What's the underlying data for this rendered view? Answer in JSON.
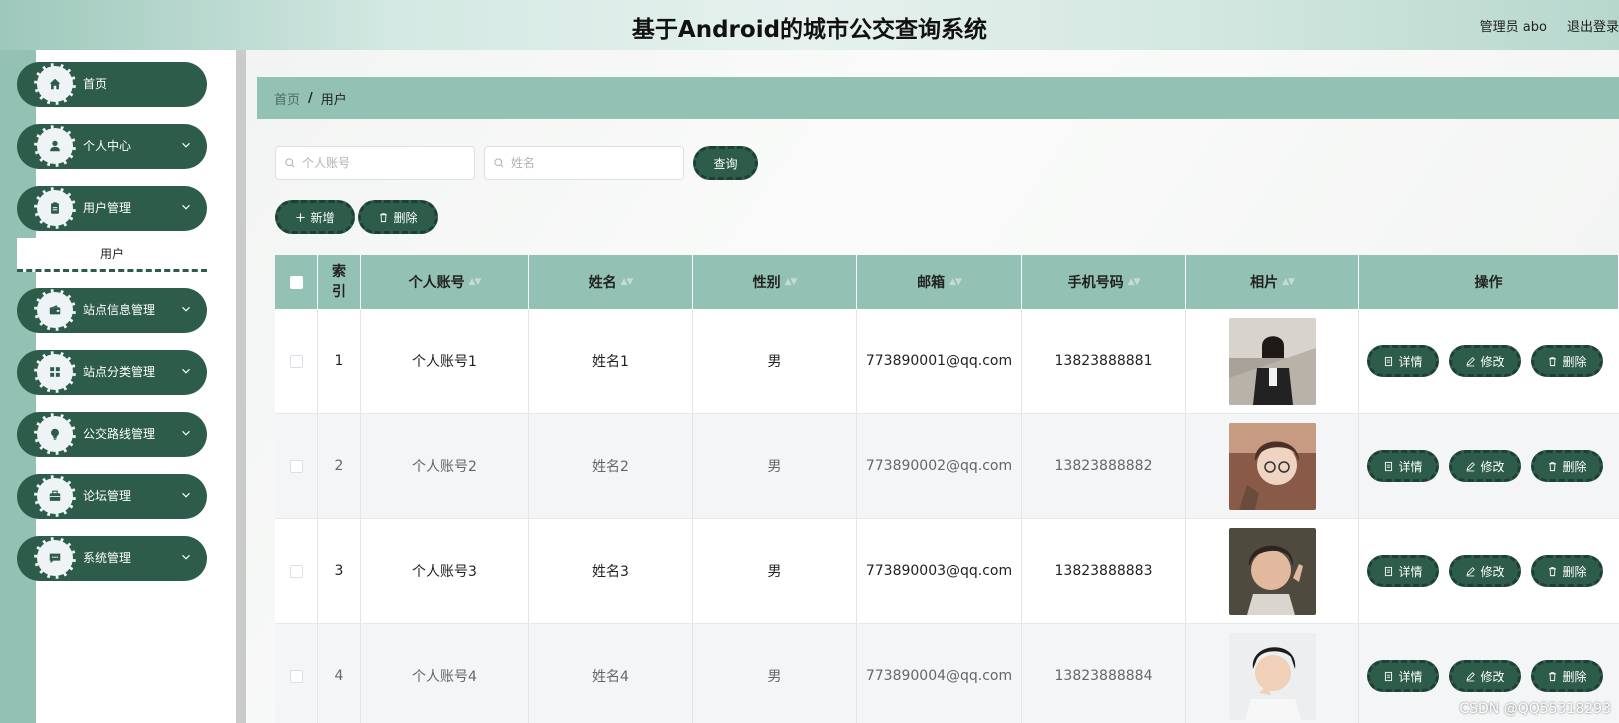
{
  "header": {
    "title": "基于Android的城市公交查询系统",
    "user_label": "管理员 abo",
    "logout_label": "退出登录"
  },
  "sidebar": {
    "items": [
      {
        "label": "首页",
        "icon": "home-icon",
        "has_children": false
      },
      {
        "label": "个人中心",
        "icon": "person-icon",
        "has_children": true
      },
      {
        "label": "用户管理",
        "icon": "clipboard-icon",
        "has_children": true
      },
      {
        "label": "站点信息管理",
        "icon": "wallet-icon",
        "has_children": true
      },
      {
        "label": "站点分类管理",
        "icon": "grid-icon",
        "has_children": true
      },
      {
        "label": "公交路线管理",
        "icon": "lightbulb-icon",
        "has_children": true
      },
      {
        "label": "论坛管理",
        "icon": "briefcase-icon",
        "has_children": true
      },
      {
        "label": "系统管理",
        "icon": "chat-icon",
        "has_children": true
      }
    ],
    "submenu": {
      "label": "用户"
    }
  },
  "breadcrumb": {
    "home": "首页",
    "separator": "/",
    "current": "用户"
  },
  "search": {
    "account_placeholder": "个人账号",
    "name_placeholder": "姓名",
    "query_label": "查询"
  },
  "toolbar": {
    "add_label": "新增",
    "delete_label": "删除"
  },
  "table": {
    "headers": [
      "索引",
      "个人账号",
      "姓名",
      "性别",
      "邮箱",
      "手机号码",
      "相片",
      "操作"
    ],
    "rows": [
      {
        "index": "1",
        "account": "个人账号1",
        "name": "姓名1",
        "gender": "男",
        "email": "773890001@qq.com",
        "phone": "13823888881"
      },
      {
        "index": "2",
        "account": "个人账号2",
        "name": "姓名2",
        "gender": "男",
        "email": "773890002@qq.com",
        "phone": "13823888882"
      },
      {
        "index": "3",
        "account": "个人账号3",
        "name": "姓名3",
        "gender": "男",
        "email": "773890003@qq.com",
        "phone": "13823888883"
      },
      {
        "index": "4",
        "account": "个人账号4",
        "name": "姓名4",
        "gender": "男",
        "email": "773890004@qq.com",
        "phone": "13823888884"
      }
    ],
    "actions": {
      "detail": "详情",
      "edit": "修改",
      "delete": "删除"
    }
  },
  "watermark": "CSDN @QQ55318293",
  "colors": {
    "primary": "#2d5c4b",
    "accent": "#93c1b3"
  }
}
